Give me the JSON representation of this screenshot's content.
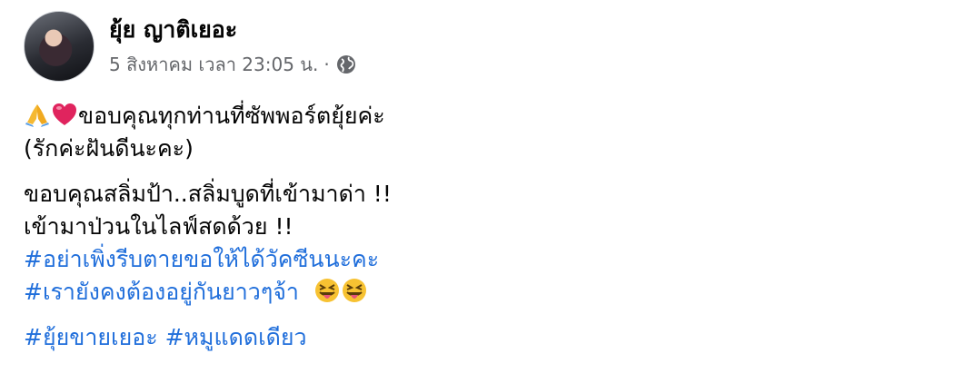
{
  "author": {
    "name": "ยุ้ย ญาติเยอะ"
  },
  "post": {
    "timestamp": "5 สิงหาคม เวลา 23:05 น.",
    "separator": "·",
    "privacy_icon": "globe-icon",
    "line1_text": "ขอบคุณทุกท่านที่ซัพพอร์ตยุ้ยค่ะ",
    "line1_emojis": [
      "folded-hands-icon",
      "red-heart-icon"
    ],
    "line2": "(รักค่ะฝันดีนะคะ)",
    "line3": "ขอบคุณสลิ่มป้า..สลิ่มบูดที่เข้ามาด่า !!",
    "line4": "เข้ามาป่วนในไลฟ์สดด้วย !!",
    "hashtag1": "#อย่าเพิ่งรีบตายขอให้ได้วัคซีนนะคะ",
    "hashtag2": "#เรายังคงต้องอยู่กันยาวๆจ้า",
    "hashtag2_emojis": [
      "squinting-tongue-face-icon",
      "squinting-tongue-face-icon"
    ],
    "hashtag3": "#ยุ้ยขายเยอะ",
    "hashtag4": "#หมูแดดเดียว"
  },
  "colors": {
    "hashtag": "#216fdb",
    "meta": "#65676b",
    "text": "#050505"
  }
}
